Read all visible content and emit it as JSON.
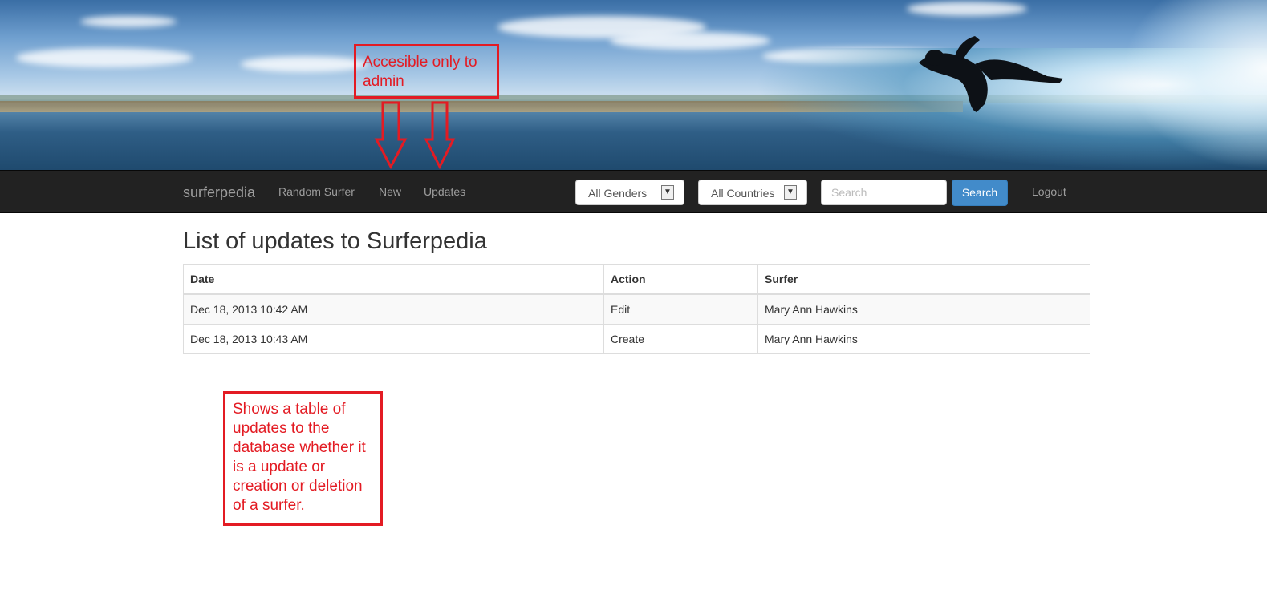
{
  "nav": {
    "brand": "surferpedia",
    "links": [
      "Random Surfer",
      "New",
      "Updates"
    ],
    "gender_select": "All Genders",
    "country_select": "All Countries",
    "search_placeholder": "Search",
    "search_button": "Search",
    "logout": "Logout"
  },
  "page": {
    "title": "List of updates to Surferpedia"
  },
  "table": {
    "headers": [
      "Date",
      "Action",
      "Surfer"
    ],
    "rows": [
      [
        "Dec 18, 2013 10:42 AM",
        "Edit",
        "Mary Ann Hawkins"
      ],
      [
        "Dec 18, 2013 10:43 AM",
        "Create",
        "Mary Ann Hawkins"
      ]
    ]
  },
  "annotations": {
    "top": "Accesible only to admin",
    "bottom": "Shows a table of updates to the database whether it is a update or creation or deletion of a surfer."
  },
  "colors": {
    "navbar_bg": "#222222",
    "nav_text": "#9d9d9d",
    "primary_button": "#428bca",
    "annotation_red": "#e31b23"
  },
  "icons": [
    "chevron-down-icon",
    "surfer-image",
    "arrow-down-icon"
  ]
}
